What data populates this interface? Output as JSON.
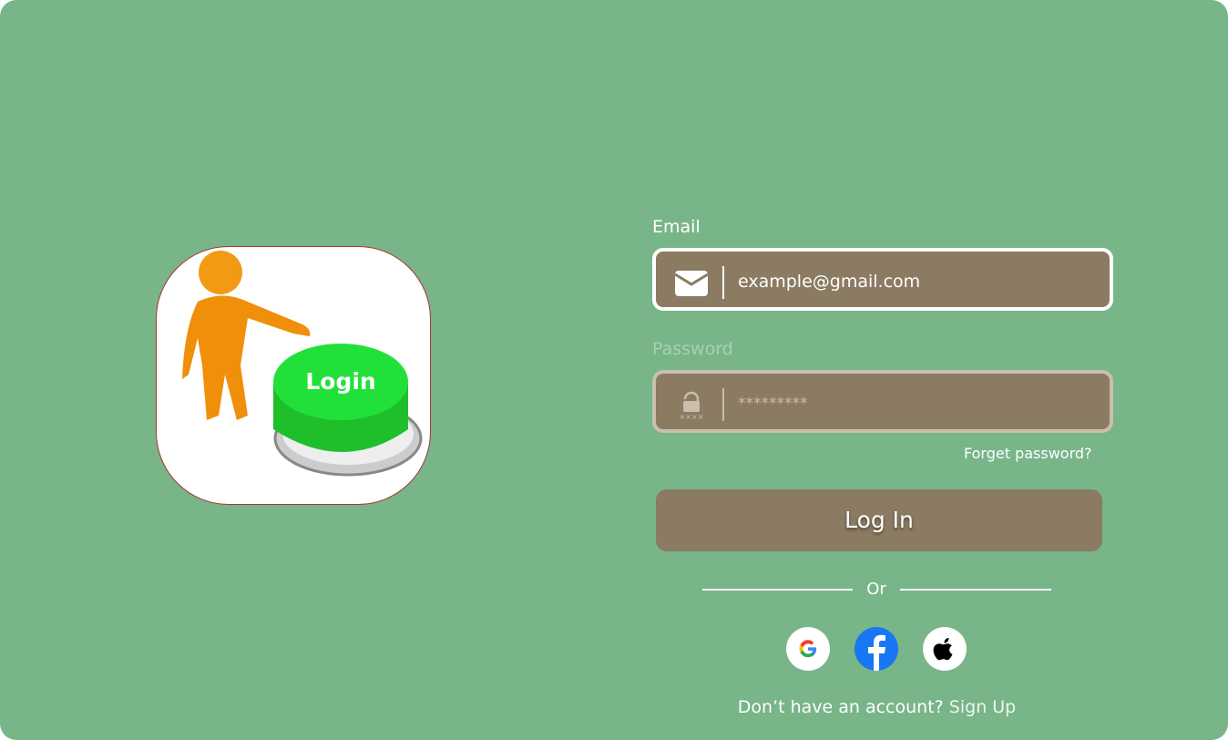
{
  "hero": {
    "image_text": "Login"
  },
  "email": {
    "label": "Email",
    "value": "example@gmail.com",
    "icon": "envelope-icon"
  },
  "password": {
    "label": "Password",
    "placeholder": "*********",
    "icon": "lock-icon"
  },
  "forgot_label": "Forget password?",
  "login_label": "Log In",
  "divider_label": "Or",
  "social": [
    {
      "name": "google",
      "icon": "google-icon"
    },
    {
      "name": "facebook",
      "icon": "facebook-icon",
      "color": "#1877f2"
    },
    {
      "name": "apple",
      "icon": "apple-icon"
    }
  ],
  "signup": {
    "prompt": "Don’t have an account?",
    "link": "Sign Up"
  },
  "colors": {
    "background": "#78b589",
    "field": "#8a7b62",
    "button": "#8a7b62"
  }
}
